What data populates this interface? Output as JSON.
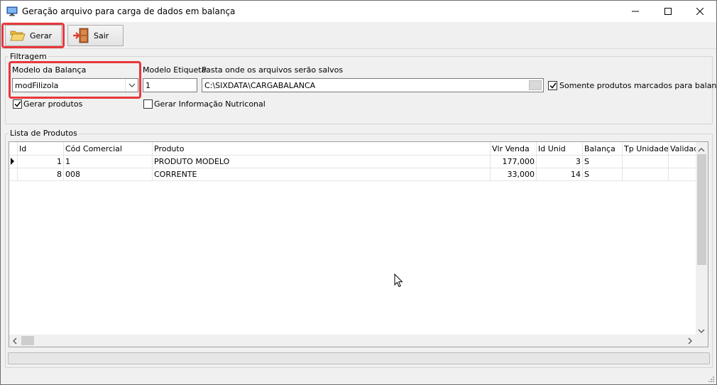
{
  "window": {
    "title": "Geração arquivo para carga de dados em balança",
    "minimize": "—",
    "maximize": "☐",
    "close": "✕"
  },
  "toolbar": {
    "gerar_label": "Gerar",
    "sair_label": "Sair"
  },
  "filtragem": {
    "group_title": "Filtragem",
    "modelo_balanca_label": "Modelo da Balança",
    "modelo_balanca_value": "modFilizola",
    "modelo_etiqueta_label": "Modelo Etiqueta",
    "modelo_etiqueta_value": "1",
    "pasta_label": "Pasta onde os arquivos serão salvos",
    "pasta_value": "C:\\SIXDATA\\CARGABALANCA",
    "somente_label": "Somente produtos marcados para balança",
    "somente_checked": true,
    "gerar_produtos_label": "Gerar produtos",
    "gerar_produtos_checked": true,
    "gerar_info_label": "Gerar Informação Nutriconal",
    "gerar_info_checked": false
  },
  "lista": {
    "group_title": "Lista de Produtos",
    "columns": [
      "Id",
      "Cód Comercial",
      "Produto",
      "Vlr Venda",
      "Id Unid",
      "Balança",
      "Tp Unidade",
      "Validade"
    ],
    "rows": [
      {
        "id": "1",
        "cod": "1",
        "produto": "PRODUTO MODELO",
        "vlr": "177,000",
        "unid": "3",
        "balanca": "S",
        "tp": "",
        "validade": ""
      },
      {
        "id": "8",
        "cod": "008",
        "produto": "CORRENTE",
        "vlr": "33,000",
        "unid": "14",
        "balanca": "S",
        "tp": "",
        "validade": ""
      }
    ]
  },
  "colors": {
    "highlight": "#e8373b",
    "window_bg": "#f0f0f0"
  }
}
